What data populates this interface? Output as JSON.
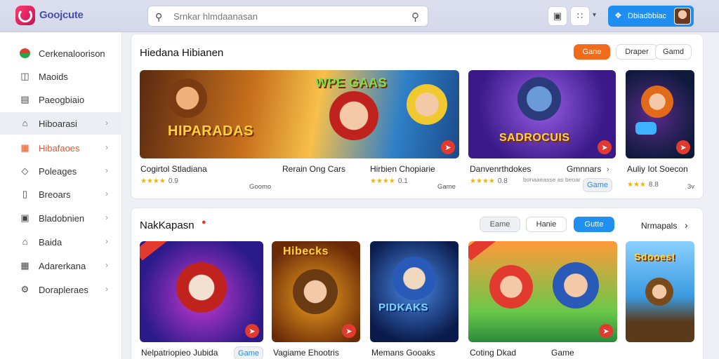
{
  "topbar": {
    "brand": "Goojcute",
    "search_placeholder": "Srnkar hlmdaanasan",
    "profile_label": "Dbiadbbiac"
  },
  "sidebar": {
    "items": [
      {
        "label": "Cerkenaloorison",
        "icon": "logo-circle-icon",
        "active": false
      },
      {
        "label": "Maoids",
        "icon": "chat-icon",
        "active": false
      },
      {
        "label": "Paeogbiaio",
        "icon": "window-icon",
        "active": false
      },
      {
        "label": "Hiboarasi",
        "icon": "home-icon",
        "active": true
      },
      {
        "label": "Hibafaoes",
        "icon": "gallery-icon",
        "active": false
      },
      {
        "label": "Poleages",
        "icon": "diamond-icon",
        "active": false
      },
      {
        "label": "Breoars",
        "icon": "file-icon",
        "active": false
      },
      {
        "label": "Bladobnien",
        "icon": "lock-icon",
        "active": false
      },
      {
        "label": "Baida",
        "icon": "home-icon",
        "active": false
      },
      {
        "label": "Adarerkana",
        "icon": "image-icon",
        "active": false
      },
      {
        "label": "Dorapleraes",
        "icon": "settings-icon",
        "active": false
      }
    ]
  },
  "section1": {
    "title": "Hiedana Hibianen",
    "filters": [
      "Gane",
      "Draper",
      "Gamd"
    ],
    "cards": [
      {
        "art_title": "HIPARADAS",
        "label": "Cogirtol Stladiana",
        "rating": "0.9",
        "tag": "Goomo",
        "extra_label": "Rerain Ong Cars"
      },
      {
        "art_title": "WPE GAAS",
        "label": "Hirbien Chopiarie",
        "rating": "0.1",
        "tag": "Game",
        "extra_label": ""
      },
      {
        "art_title": "SADROCUIS",
        "label": "Danvenrthdokes",
        "rating": "0.8",
        "tag": "Game",
        "extra_label": "Gmnnars",
        "sub": "bonaaeasse as beoar"
      },
      {
        "art_title": "",
        "label": "Auliy Iot Soecon",
        "rating": "8.8",
        "tag": "3v",
        "extra_label": ""
      }
    ]
  },
  "section2": {
    "title": "NakKapasn",
    "filters": [
      "Eame",
      "Hanie",
      "Gutte"
    ],
    "more_label": "Nrmapals",
    "cards": [
      {
        "art_title": "",
        "label": "Nelpatriopieo Jubida",
        "tag": "Game"
      },
      {
        "art_title": "Hibecks",
        "label": "Vagiame Ehootris"
      },
      {
        "art_title": "PIDKAKS",
        "label": "Memans Gooaks"
      },
      {
        "art_title": "",
        "label": "Coting Dkad",
        "tag": "Game"
      },
      {
        "art_title": "Sdooes!",
        "label": ""
      }
    ]
  },
  "colors": {
    "accent_orange": "#f26a1b",
    "accent_blue": "#1f8ff0",
    "badge_red": "#e23a2e"
  }
}
